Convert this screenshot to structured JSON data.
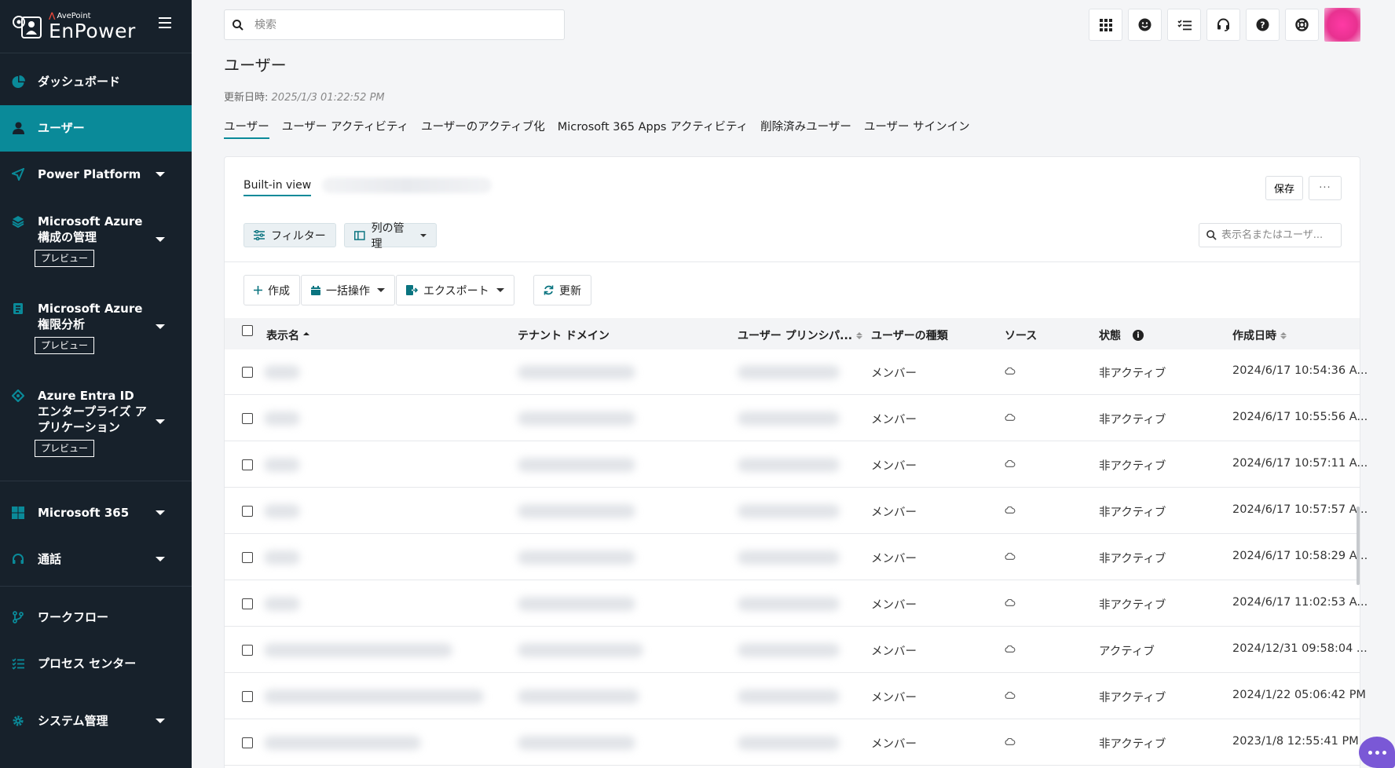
{
  "brand": {
    "company": "AvePoint",
    "product": "EnPower"
  },
  "sidebar": {
    "items": [
      {
        "label": "ダッシュボード",
        "icon": "pie-chart-icon"
      },
      {
        "label": "ユーザー",
        "icon": "user-icon"
      },
      {
        "label": "Power Platform",
        "icon": "send-icon"
      },
      {
        "label": "Microsoft Azure 構成の管理",
        "icon": "layers-icon",
        "badge": "プレビュー"
      },
      {
        "label": "Microsoft Azure 権限分析",
        "icon": "report-icon",
        "badge": "プレビュー"
      },
      {
        "label": "Azure Entra ID エンタープライズ アプリケーション",
        "icon": "diamond-icon",
        "badge": "プレビュー"
      },
      {
        "label": "Microsoft 365",
        "icon": "windows-icon"
      },
      {
        "label": "通話",
        "icon": "headset-icon"
      },
      {
        "label": "ワークフロー",
        "icon": "branch-icon"
      },
      {
        "label": "プロセス センター",
        "icon": "checklist-icon"
      },
      {
        "label": "システム管理",
        "icon": "gear-icon"
      }
    ]
  },
  "header": {
    "search_placeholder": "検索"
  },
  "page": {
    "title": "ユーザー",
    "updated_label": "更新日時:",
    "updated_value": "2025/1/3 01:22:52 PM",
    "tabs": [
      "ユーザー",
      "ユーザー アクティビティ",
      "ユーザーのアクティブ化",
      "Microsoft 365 Apps アクティビティ",
      "削除済みユーザー",
      "ユーザー サインイン"
    ]
  },
  "card": {
    "view_tab": "Built-in view",
    "save": "保存",
    "more": "···",
    "filter": "フィルター",
    "columns": "列の管理",
    "search_placeholder": "表示名またはユーザ...",
    "actions": {
      "create": "作成",
      "bulk": "一括操作",
      "export": "エクスポート",
      "refresh": "更新"
    }
  },
  "table": {
    "headers": {
      "display_name": "表示名",
      "tenant_domain": "テナント ドメイン",
      "upn": "ユーザー プリンシパ...",
      "user_type": "ユーザーの種類",
      "source": "ソース",
      "status": "状態",
      "created": "作成日時"
    },
    "rows": [
      {
        "type": "メンバー",
        "status": "非アクティブ",
        "created": "2024/6/17 10:54:36 A..."
      },
      {
        "type": "メンバー",
        "status": "非アクティブ",
        "created": "2024/6/17 10:55:56 A..."
      },
      {
        "type": "メンバー",
        "status": "非アクティブ",
        "created": "2024/6/17 10:57:11 A..."
      },
      {
        "type": "メンバー",
        "status": "非アクティブ",
        "created": "2024/6/17 10:57:57 A..."
      },
      {
        "type": "メンバー",
        "status": "非アクティブ",
        "created": "2024/6/17 10:58:29 A..."
      },
      {
        "type": "メンバー",
        "status": "非アクティブ",
        "created": "2024/6/17 11:02:53 A..."
      },
      {
        "type": "メンバー",
        "status": "アクティブ",
        "created": "2024/12/31 09:58:04 ..."
      },
      {
        "type": "メンバー",
        "status": "非アクティブ",
        "created": "2024/1/22 05:06:42 PM"
      },
      {
        "type": "メンバー",
        "status": "非アクティブ",
        "created": "2023/1/8 12:55:41 PM"
      }
    ]
  },
  "colors": {
    "sidebar_bg": "#17212b",
    "accent": "#0a8a99"
  }
}
